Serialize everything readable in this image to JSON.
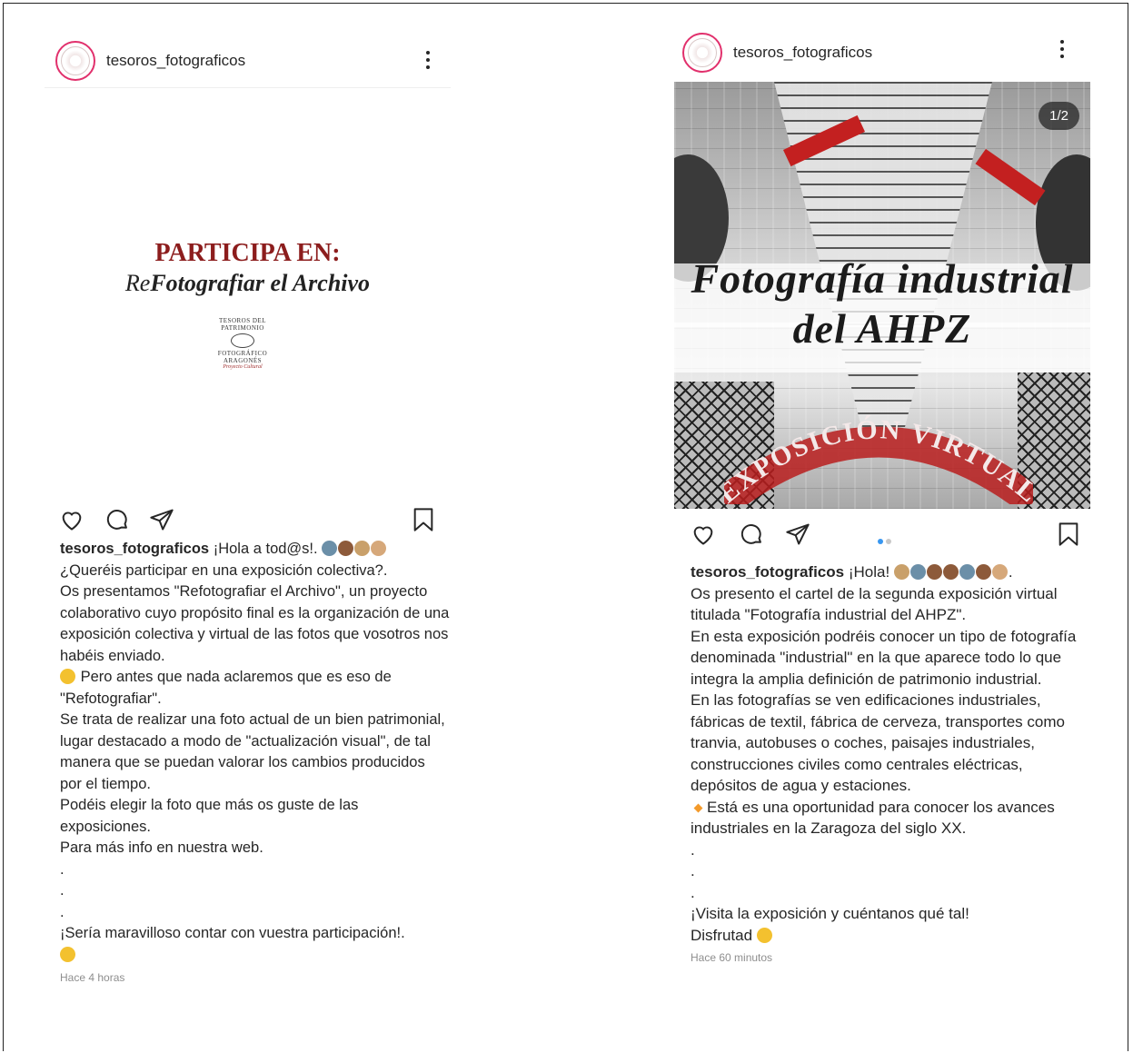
{
  "colors": {
    "text": "#262626",
    "meta": "#8e8e8e",
    "poster_red": "#8c1d1d",
    "carousel_active": "#3897f0",
    "ring": "#e1306c"
  },
  "icons": [
    "heart-icon",
    "comment-icon",
    "share-icon",
    "bookmark-icon",
    "more-options-icon"
  ],
  "post1": {
    "username": "tesoros_fotograficos",
    "poster": {
      "line1": "PARTICIPA EN:",
      "re": "Re",
      "line2": "Fotografiar el Archivo",
      "logo_line1": "TESOROS DEL PATRIMONIO",
      "logo_line2": "FOTOGRÁFICO ARAGONÉS",
      "logo_line3": "Proyecto Cultural"
    },
    "caption": {
      "user": "tesoros_fotograficos",
      "first": "¡Hola a tod@s!.",
      "lines": [
        "¿Queréis participar en una exposición colectiva?.",
        "Os presentamos \"Refotografiar el Archivo\", un proyecto colaborativo cuyo propósito final es la organización de una exposición colectiva y virtual de las fotos que vosotros nos habéis enviado."
      ],
      "thinking": "Pero antes que nada aclaremos que es eso de \"Refotografiar\".",
      "lines2": [
        "Se trata de realizar una foto actual de un bien patrimonial, lugar destacado a modo de \"actualización visual\", de tal manera que se puedan valorar los cambios producidos por el tiempo.",
        "Podéis elegir la foto que más os guste de las exposiciones.",
        "Para más info en nuestra web.",
        ".",
        ".",
        ".",
        "¡Sería maravilloso contar con vuestra participación!."
      ]
    },
    "time": "Hace 4 horas"
  },
  "post2": {
    "username": "tesoros_fotograficos",
    "counter": "1/2",
    "poster": {
      "title1": "Fotografía industrial",
      "title2": "del AHPZ",
      "arc": "EXPOSICIÓN VIRTUAL"
    },
    "carousel": {
      "current": 1,
      "total": 2
    },
    "caption": {
      "user": "tesoros_fotograficos",
      "first": "¡Hola!",
      "lines": [
        "Os presento el cartel de la segunda exposición virtual titulada \"Fotografía industrial del AHPZ\".",
        "En esta exposición podréis conocer un tipo de fotografía denominada \"industrial\" en la que aparece todo lo que integra la amplia definición de patrimonio industrial.",
        "En las fotografías se ven edificaciones industriales, fábricas de textil, fábrica de cerveza, transportes como tranvia, autobuses o coches, paisajes industriales, construcciones civiles como centrales eléctricas, depósitos de agua y estaciones."
      ],
      "highlight": "Está es una oportunidad para conocer los avances industriales en la Zaragoza del siglo XX.",
      "lines2": [
        ".",
        ".",
        ".",
        "¡Visita la exposición y cuéntanos qué tal!"
      ],
      "closing": "Disfrutad"
    },
    "time": "Hace 60 minutos"
  }
}
